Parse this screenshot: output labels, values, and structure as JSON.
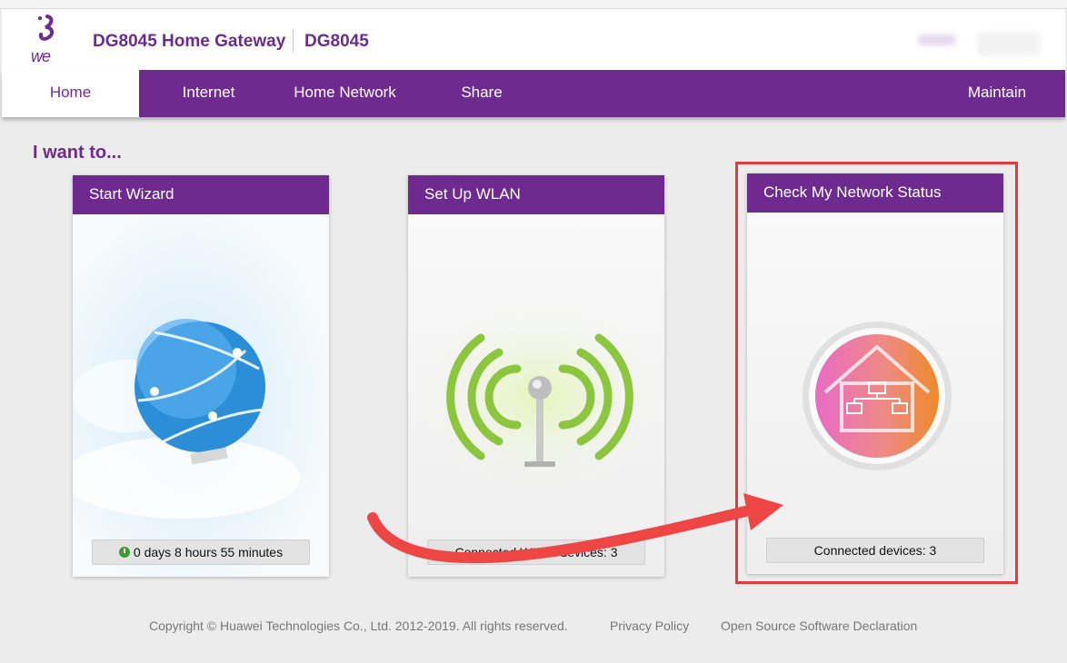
{
  "header": {
    "logo_text": "we",
    "product_name": "DG8045 Home Gateway",
    "model": "DG8045"
  },
  "nav": {
    "items": [
      {
        "label": "Home"
      },
      {
        "label": "Internet"
      },
      {
        "label": "Home Network"
      },
      {
        "label": "Share"
      },
      {
        "label": "Maintain"
      }
    ],
    "active": "Home"
  },
  "main": {
    "heading": "I want to...",
    "cards": [
      {
        "title": "Start Wizard",
        "footer": "0 days 8 hours 55 minutes",
        "icon": "globe-icon"
      },
      {
        "title": "Set Up WLAN",
        "footer": "Connected WLAN devices: 3",
        "icon": "wifi-antenna-icon"
      },
      {
        "title": "Check My Network Status",
        "footer": "Connected devices: 3",
        "icon": "home-network-icon"
      }
    ]
  },
  "footer": {
    "copyright": "Copyright © Huawei Technologies Co., Ltd. 2012-2019. All rights reserved.",
    "privacy": "Privacy Policy",
    "open_source": "Open Source Software Declaration"
  },
  "colors": {
    "brand_purple": "#6e2a8f",
    "annotation_red": "#e03a3a"
  }
}
